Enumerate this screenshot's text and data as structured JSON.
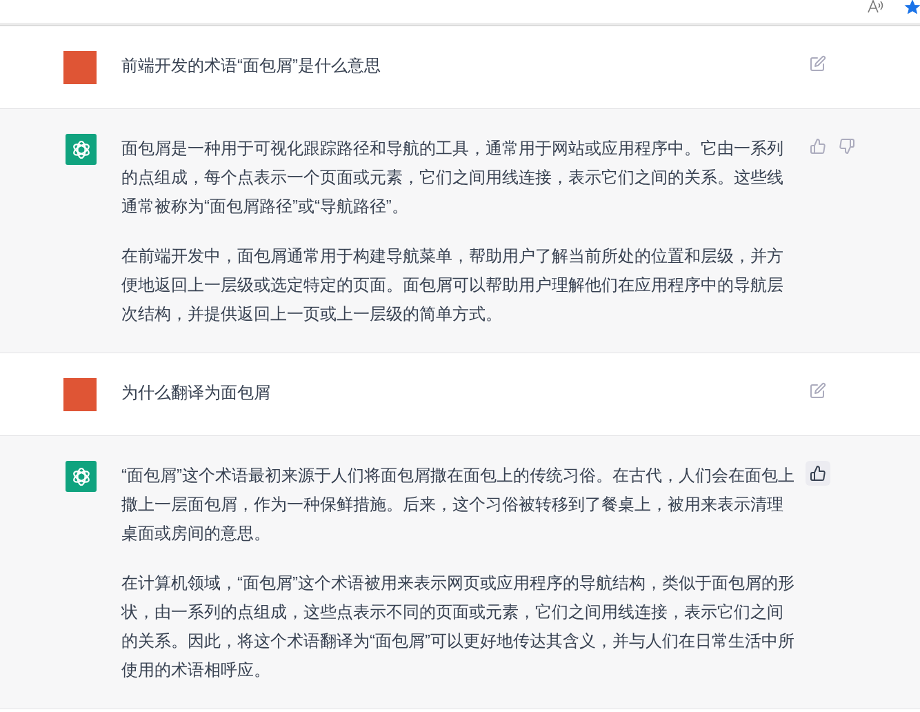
{
  "browser_toolbar": {
    "favorite_active": true
  },
  "messages": [
    {
      "kind": "user",
      "paragraphs": [
        "前端开发的术语“面包屑”是什么意思"
      ]
    },
    {
      "kind": "assistant",
      "liked": false,
      "paragraphs": [
        "面包屑是一种用于可视化跟踪路径和导航的工具，通常用于网站或应用程序中。它由一系列的点组成，每个点表示一个页面或元素，它们之间用线连接，表示它们之间的关系。这些线通常被称为“面包屑路径”或“导航路径”。",
        "在前端开发中，面包屑通常用于构建导航菜单，帮助用户了解当前所处的位置和层级，并方便地返回上一层级或选定特定的页面。面包屑可以帮助用户理解他们在应用程序中的导航层次结构，并提供返回上一页或上一层级的简单方式。"
      ]
    },
    {
      "kind": "user",
      "paragraphs": [
        "为什么翻译为面包屑"
      ]
    },
    {
      "kind": "assistant",
      "liked": true,
      "paragraphs": [
        "“面包屑”这个术语最初来源于人们将面包屑撒在面包上的传统习俗。在古代，人们会在面包上撒上一层面包屑，作为一种保鲜措施。后来，这个习俗被转移到了餐桌上，被用来表示清理桌面或房间的意思。",
        "在计算机领域，“面包屑”这个术语被用来表示网页或应用程序的导航结构，类似于面包屑的形状，由一系列的点组成，这些点表示不同的页面或元素，它们之间用线连接，表示它们之间的关系。因此，将这个术语翻译为“面包屑”可以更好地传达其含义，并与人们在日常生活中所使用的术语相呼应。"
      ]
    }
  ]
}
